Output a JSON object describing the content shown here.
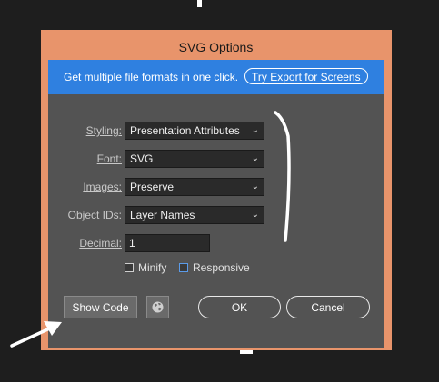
{
  "dialog": {
    "title": "SVG Options"
  },
  "banner": {
    "text": "Get multiple file formats in one click.",
    "button_label": "Try Export for Screens",
    "color": "#2f80e0"
  },
  "form": {
    "styling": {
      "label": "Styling:",
      "value": "Presentation Attributes"
    },
    "font": {
      "label": "Font:",
      "value": "SVG"
    },
    "images": {
      "label": "Images:",
      "value": "Preserve"
    },
    "object_ids": {
      "label": "Object IDs:",
      "value": "Layer Names"
    },
    "decimal": {
      "label": "Decimal:",
      "value": "1"
    },
    "minify": {
      "label": "Minify",
      "checked": false
    },
    "responsive": {
      "label": "Responsive",
      "checked": false
    }
  },
  "buttons": {
    "show_code": "Show Code",
    "ok": "OK",
    "cancel": "Cancel"
  },
  "icons": {
    "dropdown": "chevron-down-icon",
    "globe": "globe-icon",
    "arrow": "arrow-annotation"
  },
  "colors": {
    "frame": "#e8946b",
    "dialog_bg": "#535353",
    "field_bg": "#2a2a2a"
  }
}
